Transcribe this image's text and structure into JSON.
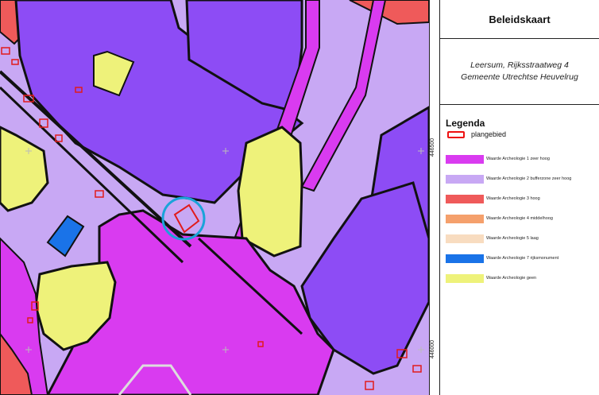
{
  "panel": {
    "title": "Beleidskaart",
    "location_line1": "Leersum, Rijksstraatweg 4",
    "location_line2": "Gemeente Utrechtse Heuvelrug"
  },
  "legend": {
    "heading": "Legenda",
    "plan_label": "plangebied",
    "plan_color": "#e11b1b",
    "items": [
      {
        "label": "Waarde Archeologie 1 zeer hoog",
        "color": "#d93bf0"
      },
      {
        "label": "Waarde Archeologie 2 bufferzone zeer hoog",
        "color": "#c8a8f4"
      },
      {
        "label": "Waarde Archeologie 3 hoog",
        "color": "#ef5a5a"
      },
      {
        "label": "Waarde Archeologie 4 middelhoog",
        "color": "#f5a06c"
      },
      {
        "label": "Waarde Archeologie 5 laag",
        "color": "#f8dcc0"
      },
      {
        "label": "Waarde Archeologie 7 rijksmonument",
        "color": "#1a73e8"
      },
      {
        "label": "Waarde Archeologie geen",
        "color": "#eef27a"
      }
    ]
  },
  "coordinates": {
    "upper": "446500",
    "lower": "446000"
  },
  "map": {
    "colors": {
      "zeer_hoog": "#d93bf0",
      "violet": "#8d4cf5",
      "buffer": "#c8a8f4",
      "hoog": "#ef5a5a",
      "geen": "#eef27a",
      "rijksmonument": "#1a73e8",
      "marker": "#1aa3d9"
    }
  }
}
